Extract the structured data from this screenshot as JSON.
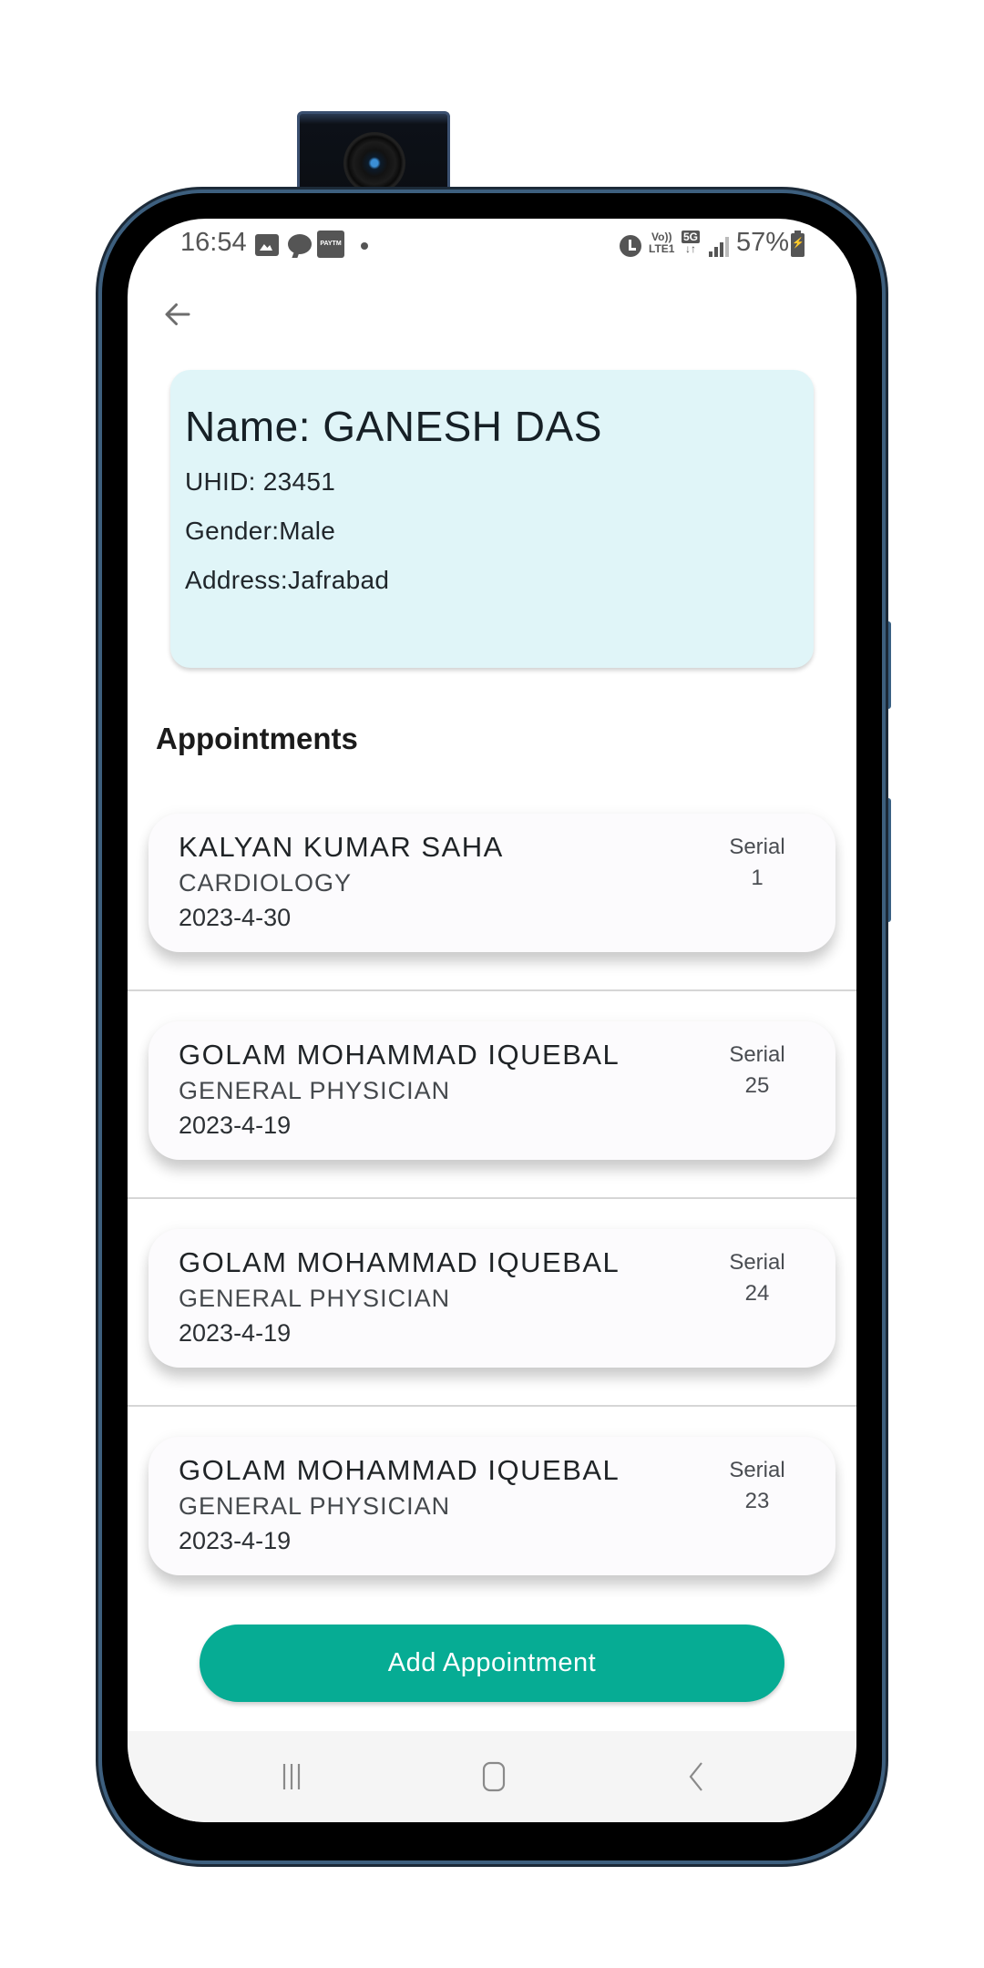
{
  "status_bar": {
    "time": "16:54",
    "notification_icons": [
      "gallery-icon",
      "chat-icon",
      "paytm-icon",
      "more-dot-icon"
    ],
    "paytm_label": "PAYTM",
    "volte_label_top": "Vo))",
    "volte_label_bottom": "LTE1",
    "network_label": "5G",
    "network_arrows": "↓↑",
    "battery_percent": "57%"
  },
  "app_bar": {
    "back_icon": "arrow-left-icon"
  },
  "patient": {
    "name": "Name: GANESH DAS",
    "uhid": "UHID: 23451",
    "gender": "Gender:Male",
    "address": "Address:Jafrabad"
  },
  "appointments_section": {
    "title": "Appointments",
    "serial_label": "Serial",
    "items": [
      {
        "doctor": "KALYAN KUMAR SAHA",
        "department": "CARDIOLOGY",
        "date": "2023-4-30",
        "serial": "1"
      },
      {
        "doctor": "GOLAM MOHAMMAD IQUEBAL",
        "department": "GENERAL PHYSICIAN",
        "date": "2023-4-19",
        "serial": "25"
      },
      {
        "doctor": "GOLAM MOHAMMAD IQUEBAL",
        "department": "GENERAL PHYSICIAN",
        "date": "2023-4-19",
        "serial": "24"
      },
      {
        "doctor": "GOLAM MOHAMMAD IQUEBAL",
        "department": "GENERAL PHYSICIAN",
        "date": "2023-4-19",
        "serial": "23"
      }
    ]
  },
  "actions": {
    "add_appointment_label": "Add Appointment"
  },
  "colors": {
    "patient_card_bg": "#E0F5F8",
    "primary_button": "#06AC94",
    "nav_bar_bg": "#F5F5F5"
  },
  "nav_bar": {
    "buttons": [
      "recent-apps-icon",
      "home-icon",
      "back-icon"
    ]
  }
}
